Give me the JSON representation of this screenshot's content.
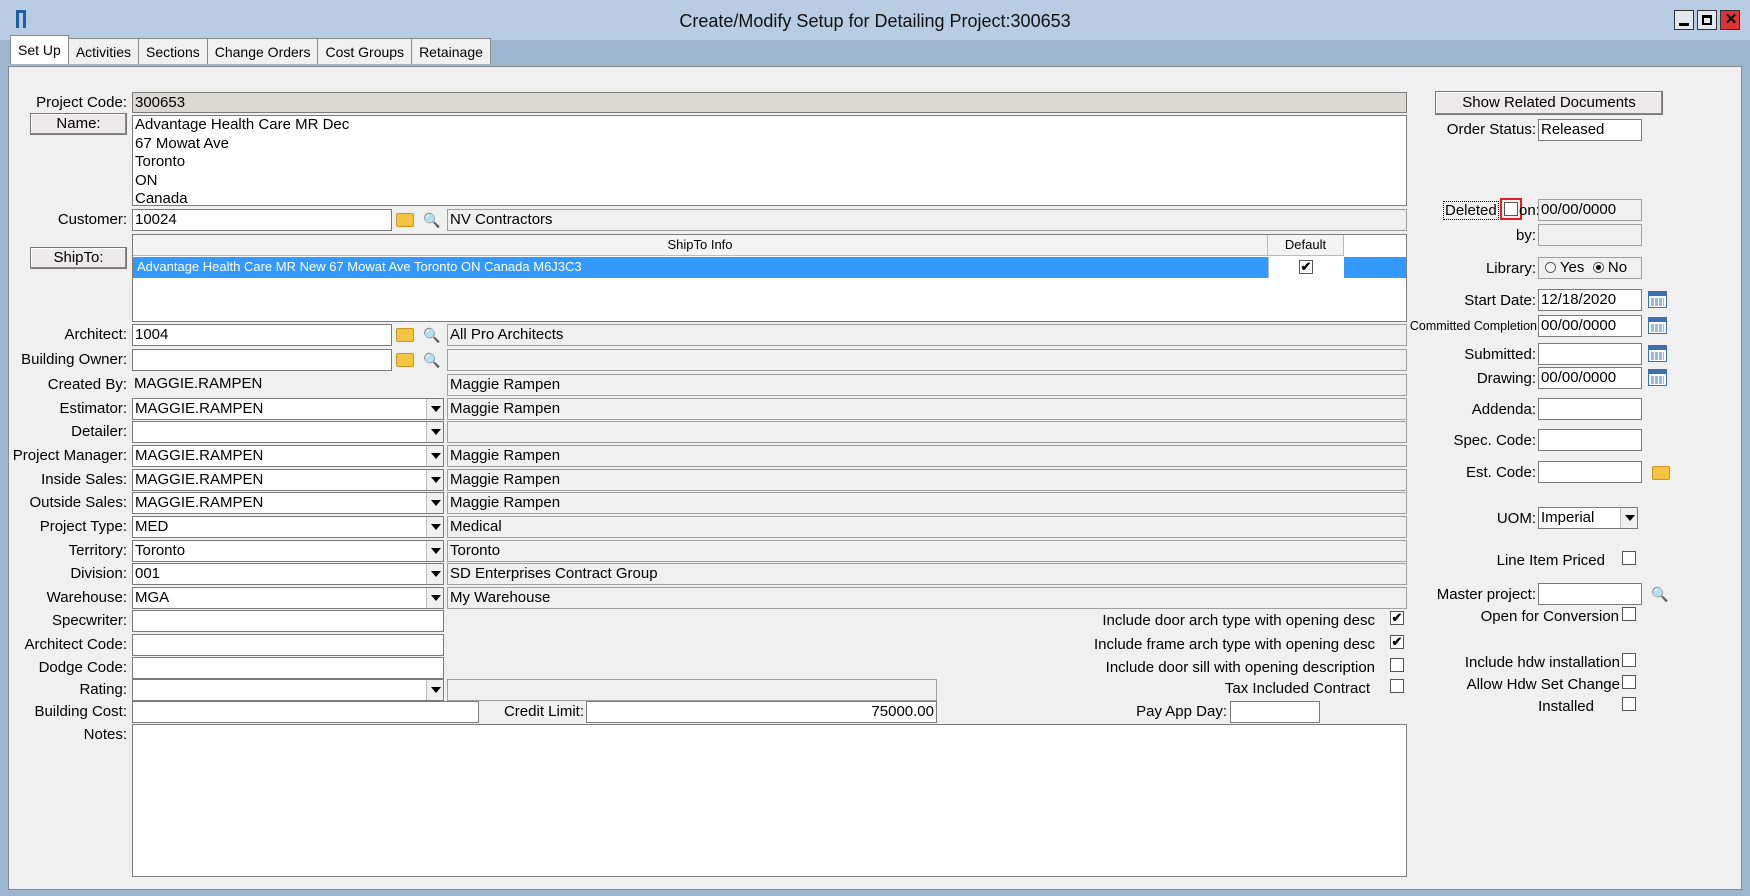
{
  "window": {
    "title": "Create/Modify Setup for Detailing Project:300653"
  },
  "tabs": [
    "Set Up",
    "Activities",
    "Sections",
    "Change Orders",
    "Cost Groups",
    "Retainage"
  ],
  "form": {
    "project_code_label": "Project Code:",
    "project_code": "300653",
    "name_button": "Name:",
    "name_lines": [
      "Advantage Health Care MR Dec",
      "67 Mowat Ave",
      "Toronto",
      "ON",
      "Canada"
    ],
    "customer_label": "Customer:",
    "customer_code": "10024",
    "customer_name": "NV Contractors",
    "shipto_button": "ShipTo:",
    "shipto_headers": {
      "info": "ShipTo Info",
      "default": "Default"
    },
    "shipto_row": "Advantage Health Care MR New 67 Mowat Ave Toronto ON Canada M6J3C3",
    "architect_label": "Architect:",
    "architect_code": "1004",
    "architect_name": "All Pro Architects",
    "building_owner_label": "Building Owner:",
    "created_by_label": "Created By:",
    "created_by": "MAGGIE.RAMPEN",
    "created_by_name": "Maggie Rampen",
    "estimator_label": "Estimator:",
    "estimator": "MAGGIE.RAMPEN",
    "estimator_name": "Maggie Rampen",
    "detailer_label": "Detailer:",
    "pm_label": "Project Manager:",
    "pm": "MAGGIE.RAMPEN",
    "pm_name": "Maggie Rampen",
    "inside_sales_label": "Inside Sales:",
    "inside_sales": "MAGGIE.RAMPEN",
    "inside_sales_name": "Maggie Rampen",
    "outside_sales_label": "Outside Sales:",
    "outside_sales": "MAGGIE.RAMPEN",
    "outside_sales_name": "Maggie Rampen",
    "project_type_label": "Project Type:",
    "project_type": "MED",
    "project_type_name": "Medical",
    "territory_label": "Territory:",
    "territory": "Toronto",
    "territory_name": "Toronto",
    "division_label": "Division:",
    "division": "001",
    "division_name": "SD Enterprises Contract Group",
    "warehouse_label": "Warehouse:",
    "warehouse": "MGA",
    "warehouse_name": "My Warehouse",
    "specwriter_label": "Specwriter:",
    "architect_code_label": "Architect Code:",
    "dodge_code_label": "Dodge Code:",
    "rating_label": "Rating:",
    "building_cost_label": "Building Cost:",
    "credit_limit_label": "Credit Limit:",
    "credit_limit": "75000.00",
    "notes_label": "Notes:",
    "opt_door_arch": "Include door arch type with opening desc",
    "opt_frame_arch": "Include frame arch type with opening desc",
    "opt_door_sill": "Include door sill with opening description",
    "opt_tax": "Tax Included Contract",
    "pay_app_label": "Pay App Day:"
  },
  "right": {
    "related_docs": "Show Related Documents",
    "order_status_label": "Order Status:",
    "order_status": "Released",
    "deleted_label": "Deleted",
    "on_label": "on:",
    "deleted_on": "00/00/0000",
    "by_label": "by:",
    "library_label": "Library:",
    "yes": "Yes",
    "no": "No",
    "start_date_label": "Start Date:",
    "start_date": "12/18/2020",
    "committed_label": "Committed Completion",
    "committed": "00/00/0000",
    "submitted_label": "Submitted:",
    "drawing_label": "Drawing:",
    "drawing": "00/00/0000",
    "addenda_label": "Addenda:",
    "spec_code_label": "Spec. Code:",
    "est_code_label": "Est. Code:",
    "uom_label": "UOM:",
    "uom": "Imperial",
    "line_item_label": "Line Item Priced",
    "master_project_label": "Master project:",
    "open_conv_label": "Open for Conversion",
    "hdw_install_label": "Include hdw installation",
    "hdw_set_label": "Allow Hdw Set Change",
    "installed_label": "Installed"
  }
}
